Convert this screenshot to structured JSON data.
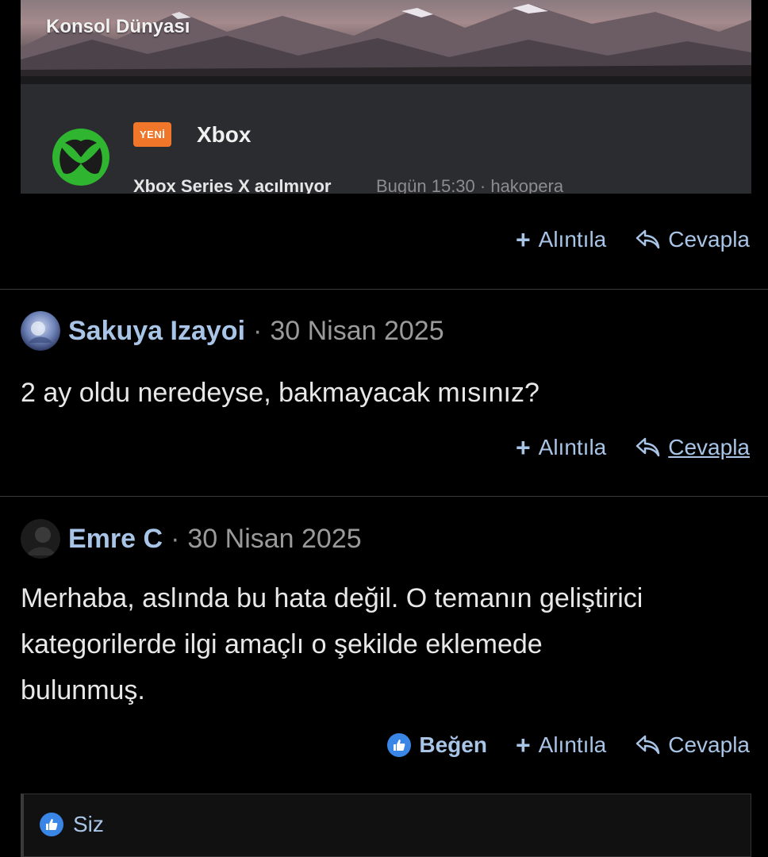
{
  "embed": {
    "category_title": "Konsol Dünyası",
    "badge": "YENİ",
    "forum_name": "Xbox",
    "thread_title": "Xbox Series X acılmıyor",
    "thread_meta": "Bugün 15:30 · hakopera",
    "logo_icon": "xbox-logo-icon"
  },
  "action_labels": {
    "quote": "Alıntıla",
    "reply": "Cevapla",
    "like": "Beğen"
  },
  "posts": [
    {
      "username": "Sakuya Izayoi",
      "separator": "·",
      "date": "30 Nisan 2025",
      "body": "2 ay oldu neredeyse, bakmayacak mısınız?"
    },
    {
      "username": "Emre C",
      "separator": "·",
      "date": "30 Nisan 2025",
      "body": "Merhaba, aslında bu hata değil. O temanın geliştirici kategorilerde ilgi amaçlı o şekilde eklemede bulunmuş."
    }
  ],
  "reactions": {
    "who": "Siz"
  },
  "colors": {
    "link": "#a8c4e6",
    "badge": "#f0762a",
    "xbox_green": "#2fb52f",
    "like_blue": "#3a86e6"
  }
}
